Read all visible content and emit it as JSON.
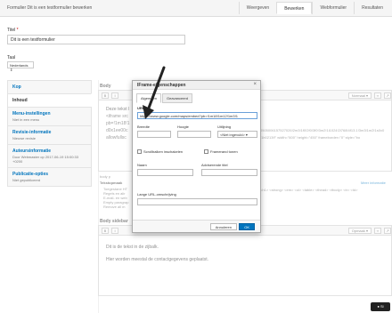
{
  "topbar": {
    "title": "Formulier Dit is een testformulier bewerken",
    "tabs": [
      "Weergeven",
      "Bewerken",
      "Webformulier",
      "Resultaten"
    ]
  },
  "title_field": {
    "label": "Titel",
    "required": "*",
    "value": "Dit is een testformulier"
  },
  "taal": {
    "label": "Taal",
    "value": "Nederlands"
  },
  "vtabs": [
    {
      "title": "Kop",
      "sub": ""
    },
    {
      "title": "Inhoud",
      "sub": ""
    },
    {
      "title": "Menu-instellingen",
      "sub": "Niet in een menu"
    },
    {
      "title": "Revisie-informatie",
      "sub": "Nieuwe revisie"
    },
    {
      "title": "Auteursinformatie",
      "sub": "Door Webmaster op 2017-06-19 15:00:33 +0200"
    },
    {
      "title": "Publicatie-opties",
      "sub": "Niet gepubliceerd"
    }
  ],
  "body": {
    "label": "Body",
    "format_select": "Normaal",
    "line1": "Deze tekst l",
    "line2": "<iframe src",
    "line3": "pb=!1m18!1",
    "line4": "d0x1ee00c",
    "line5": "allowfullsc",
    "right_code": "0505006157527026!2m3!1f0!2f0!3f0!3m2!1i1024!2i768!4f13.1!3m3!1m2!1s0x0",
    "right_code2": "f1b0213f!\" width=\"600\" height=\"450\" frameborder=\"0\" style=\"bo",
    "status": "body  p",
    "more_info": "Meer informatie",
    "text_format": "Tekstopmaak",
    "allowed_tags": "<h1> <strong> <em> <ol> <table> <thead> <tbody> <tr> <td>",
    "bullets": [
      "Toegestane HT",
      "Regels en alir",
      "E-mail- en web",
      "Empty paragrap",
      "Remove all m"
    ]
  },
  "sidebar": {
    "label": "Body sidebar",
    "format_select": "Opmaak",
    "line1": "Dit is de tekst in de zijbalk.",
    "line2": "Hier worden meestal de contactgegevens geplaatst."
  },
  "dialog": {
    "title": "IFrame-eigenschappen",
    "close": "×",
    "tabs": [
      "Algemeen",
      "Geavanceerd"
    ],
    "url_label": "URL",
    "url_value": "https://www.google.com/maps/embed?pb=!1m18!1m12!1m3!1",
    "width_label": "Breedte",
    "height_label": "Hoogte",
    "align_label": "Uitlijning",
    "align_value": "<Niet ingevuld>",
    "scroll_label": "Scrollbalken inschakelen",
    "frame_label": "Framerand tonen",
    "name_label": "Naam",
    "title_label": "Adviserende titel",
    "longdesc_label": "Lange URL-omschrijving",
    "cancel": "Annuleren",
    "ok": "OK"
  },
  "cookie": "Sl"
}
